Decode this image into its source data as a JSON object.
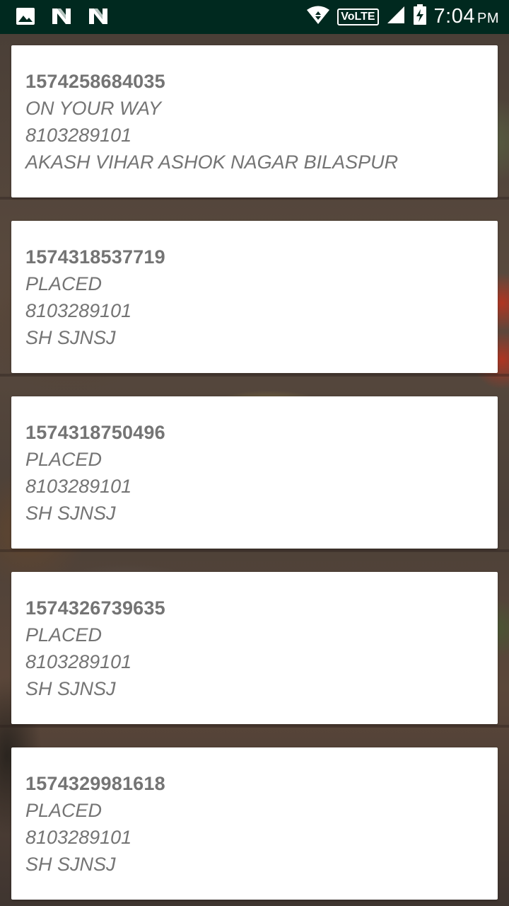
{
  "status_bar": {
    "left_icons": [
      "image-icon",
      "n-notification-icon",
      "n-notification-icon"
    ],
    "right_icons": [
      "wifi-data-icon",
      "signal-icon",
      "battery-charging-icon"
    ],
    "volte_label": "VoLTE",
    "time": "7:04",
    "ampm": "PM"
  },
  "orders": [
    {
      "order_id": "1574258684035",
      "status": "ON YOUR WAY",
      "phone": "8103289101",
      "address": "AKASH VIHAR ASHOK NAGAR BILASPUR"
    },
    {
      "order_id": "1574318537719",
      "status": "PLACED",
      "phone": "8103289101",
      "address": "SH SJNSJ"
    },
    {
      "order_id": "1574318750496",
      "status": "PLACED",
      "phone": "8103289101",
      "address": "SH SJNSJ"
    },
    {
      "order_id": "1574326739635",
      "status": "PLACED",
      "phone": "8103289101",
      "address": "SH SJNSJ"
    },
    {
      "order_id": "1574329981618",
      "status": "PLACED",
      "phone": "8103289101",
      "address": "SH SJNSJ"
    }
  ],
  "colors": {
    "status_bar": "#00291f",
    "card_background": "#ffffff",
    "card_text": "#747474"
  }
}
